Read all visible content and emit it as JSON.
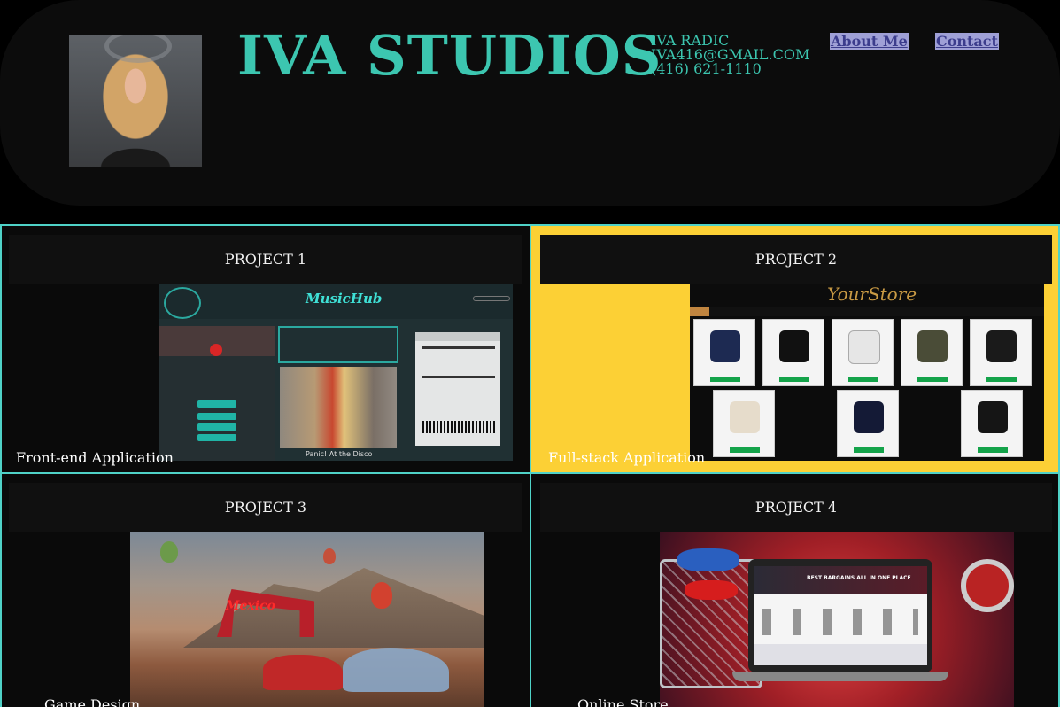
{
  "header": {
    "brand": "IVA STUDIOS",
    "name": "IVA RADIC",
    "email": "IVA416@GMAIL.COM",
    "phone": "(416) 621-1110",
    "nav": [
      {
        "label": "About Me"
      },
      {
        "label": "Contact"
      }
    ]
  },
  "projects": [
    {
      "title": "PROJECT 1",
      "label": "Front-end Application",
      "thumb_title": "MusicHub",
      "thumb_caption": "Panic! At the Disco"
    },
    {
      "title": "PROJECT 2",
      "label": "Full-stack Application",
      "thumb_title": "YourStore"
    },
    {
      "title": "PROJECT 3",
      "label": "Game Design",
      "thumb_title": "Mexico"
    },
    {
      "title": "PROJECT 4",
      "label": "Online Store",
      "thumb_title": "BEST BARGAINS ALL IN ONE PLACE"
    }
  ],
  "colors": {
    "accent": "#3cc6b0",
    "card_border": "#4fd2c7",
    "highlight_card": "#fcd035",
    "nav_bg": "#9fa0d6",
    "nav_text": "#3b3c8c"
  }
}
